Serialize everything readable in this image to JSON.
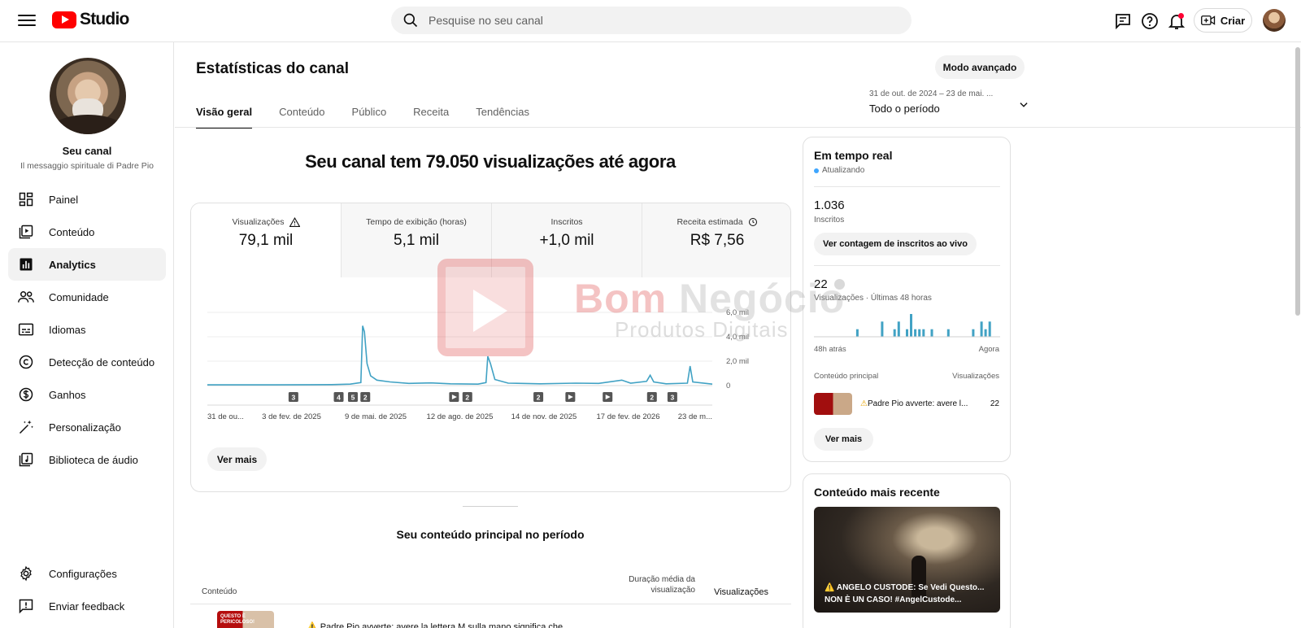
{
  "app": {
    "brand": "Studio"
  },
  "search": {
    "placeholder": "Pesquise no seu canal"
  },
  "header": {
    "create_label": "Criar"
  },
  "channel": {
    "name": "Seu canal",
    "subtitle": "Il messaggio spirituale di Padre Pio"
  },
  "sidebar": {
    "items": [
      {
        "label": "Painel",
        "icon": "dashboard-icon"
      },
      {
        "label": "Conteúdo",
        "icon": "content-icon"
      },
      {
        "label": "Analytics",
        "icon": "analytics-icon",
        "active": true
      },
      {
        "label": "Comunidade",
        "icon": "community-icon"
      },
      {
        "label": "Idiomas",
        "icon": "subtitles-icon"
      },
      {
        "label": "Detecção de conteúdo",
        "icon": "copyright-icon"
      },
      {
        "label": "Ganhos",
        "icon": "dollar-icon"
      },
      {
        "label": "Personalização",
        "icon": "magic-wand-icon"
      },
      {
        "label": "Biblioteca de áudio",
        "icon": "audio-library-icon"
      }
    ],
    "bottom": [
      {
        "label": "Configurações",
        "icon": "gear-icon"
      },
      {
        "label": "Enviar feedback",
        "icon": "feedback-icon"
      }
    ]
  },
  "page": {
    "title": "Estatísticas do canal",
    "advanced_mode": "Modo avançado",
    "date_range_dates": "31 de out. de 2024 – 23 de mai. ...",
    "date_range_label": "Todo o período",
    "tabs": [
      "Visão geral",
      "Conteúdo",
      "Público",
      "Receita",
      "Tendências"
    ],
    "headline": "Seu canal tem 79.050 visualizações até agora"
  },
  "metrics": [
    {
      "label": "Visualizações",
      "value": "79,1 mil"
    },
    {
      "label": "Tempo de exibição (horas)",
      "value": "5,1 mil"
    },
    {
      "label": "Inscritos",
      "value": "+1,0 mil"
    },
    {
      "label": "Receita estimada",
      "value": "R$ 7,56"
    }
  ],
  "chart_data": {
    "type": "line",
    "ylim": [
      0,
      6000
    ],
    "y_ticks": [
      "0",
      "2,0 mil",
      "4,0 mil",
      "6,0 mil"
    ],
    "x_tick_labels": [
      "31 de ou...",
      "3 de fev. de 2025",
      "9 de mai. de 2025",
      "12 de ago. de 2025",
      "14 de nov. de 2025",
      "17 de fev. de 2026",
      "23 de m..."
    ],
    "x_start": "2024-10-31",
    "x_end": "2026-05-23",
    "series": [
      {
        "points": [
          [
            "2024-10-31",
            60
          ],
          [
            "2025-01-15",
            60
          ],
          [
            "2025-03-20",
            80
          ],
          [
            "2025-04-10",
            120
          ],
          [
            "2025-04-22",
            250
          ],
          [
            "2025-04-24",
            4900
          ],
          [
            "2025-04-26",
            4400
          ],
          [
            "2025-04-29",
            1800
          ],
          [
            "2025-05-03",
            800
          ],
          [
            "2025-05-10",
            450
          ],
          [
            "2025-05-25",
            300
          ],
          [
            "2025-06-15",
            180
          ],
          [
            "2025-07-10",
            220
          ],
          [
            "2025-08-01",
            150
          ],
          [
            "2025-09-01",
            120
          ],
          [
            "2025-09-10",
            250
          ],
          [
            "2025-09-12",
            2400
          ],
          [
            "2025-09-15",
            1800
          ],
          [
            "2025-09-20",
            500
          ],
          [
            "2025-10-05",
            200
          ],
          [
            "2025-11-10",
            150
          ],
          [
            "2025-12-20",
            200
          ],
          [
            "2026-01-15",
            180
          ],
          [
            "2026-02-10",
            450
          ],
          [
            "2026-02-20",
            200
          ],
          [
            "2026-03-10",
            350
          ],
          [
            "2026-03-14",
            850
          ],
          [
            "2026-03-18",
            300
          ],
          [
            "2026-04-01",
            150
          ],
          [
            "2026-04-25",
            200
          ],
          [
            "2026-04-28",
            1600
          ],
          [
            "2026-05-01",
            300
          ],
          [
            "2026-05-23",
            120
          ]
        ]
      }
    ],
    "annotations": [
      {
        "date": "2025-02-05",
        "label": "3"
      },
      {
        "date": "2025-03-28",
        "label": "4"
      },
      {
        "date": "2025-04-13",
        "label": "5"
      },
      {
        "date": "2025-04-27",
        "label": "2"
      },
      {
        "date": "2025-08-05",
        "label": "video"
      },
      {
        "date": "2025-08-20",
        "label": "2"
      },
      {
        "date": "2025-11-08",
        "label": "2"
      },
      {
        "date": "2025-12-14",
        "label": "video"
      },
      {
        "date": "2026-01-25",
        "label": "video"
      },
      {
        "date": "2026-03-16",
        "label": "2"
      },
      {
        "date": "2026-04-08",
        "label": "3"
      }
    ],
    "line_color": "#41a2c4"
  },
  "stats": {
    "see_more": "Ver mais"
  },
  "top_content": {
    "title": "Seu conteúdo principal no período",
    "col_content": "Conteúdo",
    "col_duration": "Duração média da visualização",
    "col_views": "Visualizações",
    "rows": [
      {
        "title": "⚠️ Padre Pio avverte: avere la lettera M sulla mano significa che...",
        "thumb_text": "QUESTO È PERICOLOSO!"
      }
    ]
  },
  "realtime": {
    "title": "Em tempo real",
    "status": "Atualizando",
    "subs_value": "1.036",
    "subs_label": "Inscritos",
    "live_button": "Ver contagem de inscritos ao vivo",
    "views_value": "22",
    "views_label": "Visualizações · Últimas 48 horas",
    "axis_left": "48h atrás",
    "axis_right": "Agora",
    "col_left": "Conteúdo principal",
    "col_right": "Visualizações",
    "item_title": "Padre Pio avverte: avere l...",
    "item_value": "22",
    "more_button": "Ver mais",
    "bars": [
      0,
      0,
      0,
      0,
      0,
      0,
      0,
      0,
      0,
      0,
      1,
      0,
      0,
      0,
      0,
      0,
      2,
      0,
      0,
      1,
      2,
      0,
      1,
      3,
      1,
      1,
      1,
      0,
      1,
      0,
      0,
      0,
      1,
      0,
      0,
      0,
      0,
      0,
      1,
      0,
      2,
      1,
      2,
      0,
      0
    ]
  },
  "recent": {
    "title": "Conteúdo mais recente",
    "caption": "⚠️ ANGELO CUSTODE: Se Vedi Questo... NON È UN CASO! #AngelCustode..."
  },
  "watermark": {
    "text1a": "Bom ",
    "text1b": "Negócio",
    "text2": "Produtos Digitais"
  },
  "colors": {
    "accent": "#41a2c4",
    "brand_red": "#ff0000",
    "live_dot": "#3ea6ff"
  }
}
